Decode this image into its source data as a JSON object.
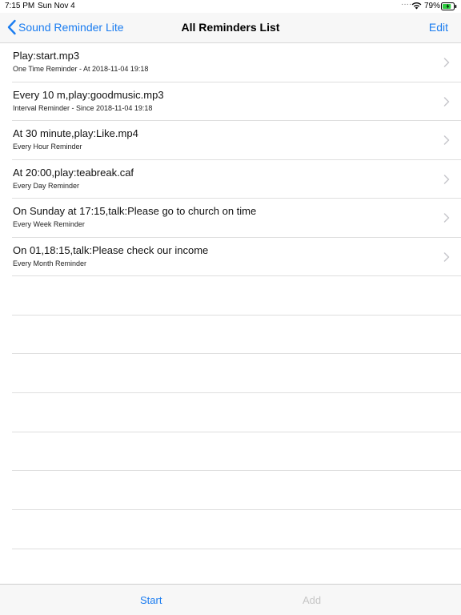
{
  "status_bar": {
    "time": "7:15 PM",
    "date": "Sun Nov 4",
    "battery_percent": "79%",
    "battery_level": 0.79
  },
  "nav": {
    "back_label": "Sound Reminder Lite",
    "title": "All Reminders List",
    "edit_label": "Edit"
  },
  "reminders": [
    {
      "title": "Play:start.mp3",
      "subtitle": "One Time Reminder - At 2018-11-04 19:18"
    },
    {
      "title": "Every 10 m,play:goodmusic.mp3",
      "subtitle": "Interval Reminder - Since 2018-11-04 19:18"
    },
    {
      "title": "At 30 minute,play:Like.mp4",
      "subtitle": "Every Hour Reminder"
    },
    {
      "title": "At 20:00,play:teabreak.caf",
      "subtitle": "Every Day Reminder"
    },
    {
      "title": "On Sunday at 17:15,talk:Please go to church on time",
      "subtitle": "Every Week Reminder"
    },
    {
      "title": "On 01,18:15,talk:Please check our income",
      "subtitle": "Every Month Reminder"
    }
  ],
  "toolbar": {
    "start_label": "Start",
    "add_label": "Add"
  },
  "colors": {
    "accent": "#1a7cf0",
    "disabled": "#c6c6c6",
    "separator": "#dedede"
  }
}
